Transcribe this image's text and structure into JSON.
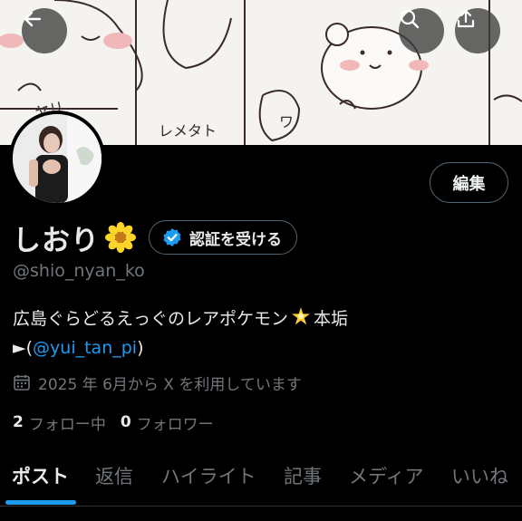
{
  "header": {
    "back_icon": "arrow-left-icon",
    "search_icon": "search-icon",
    "share_icon": "share-upload-icon"
  },
  "banner": {
    "texts": [
      "レメタト",
      "ワ",
      "ヤリ"
    ]
  },
  "profile": {
    "display_name": "しおり",
    "name_emoji": "flower-icon",
    "verify_label": "認証を受ける",
    "handle": "@shio_nyan_ko",
    "edit_label": "編集"
  },
  "bio": {
    "line1": "広島ぐらどるえっぐのレアポケモン",
    "line1_tail": "本垢",
    "line2_prefix": "►(",
    "line2_link": "@yui_tan_pi",
    "line2_suffix": ")"
  },
  "joined": {
    "text": "2025 年 6月から X を利用しています",
    "icon": "calendar-icon"
  },
  "stats": {
    "following_count": "2",
    "following_label": "フォロー中",
    "followers_count": "0",
    "followers_label": "フォロワー"
  },
  "tabs": [
    {
      "label": "ポスト",
      "active": true
    },
    {
      "label": "返信",
      "active": false
    },
    {
      "label": "ハイライト",
      "active": false
    },
    {
      "label": "記事",
      "active": false
    },
    {
      "label": "メディア",
      "active": false
    },
    {
      "label": "いいね",
      "active": false
    }
  ],
  "colors": {
    "accent": "#1d9bf0",
    "background": "#000000",
    "secondary_text": "#71767b"
  }
}
